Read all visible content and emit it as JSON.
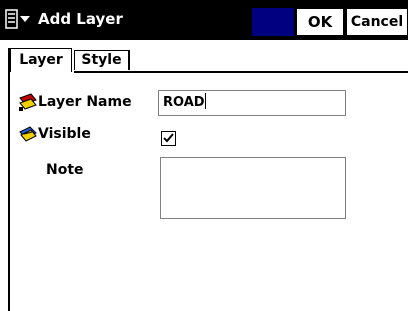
{
  "titlebar": {
    "title": "Add Layer",
    "ok_label": "OK",
    "cancel_label": "Cancel",
    "menu_icon": "start-menu-icon"
  },
  "tabs": [
    {
      "label": "Layer",
      "active": true
    },
    {
      "label": "Style",
      "active": false
    }
  ],
  "form": {
    "layer_name_label": "Layer Name",
    "layer_name_value": "ROAD",
    "visible_label": "Visible",
    "visible_checked": true,
    "note_label": "Note",
    "note_value": ""
  },
  "colors": {
    "titlebar": "#000000",
    "accent_block": "#000080"
  }
}
